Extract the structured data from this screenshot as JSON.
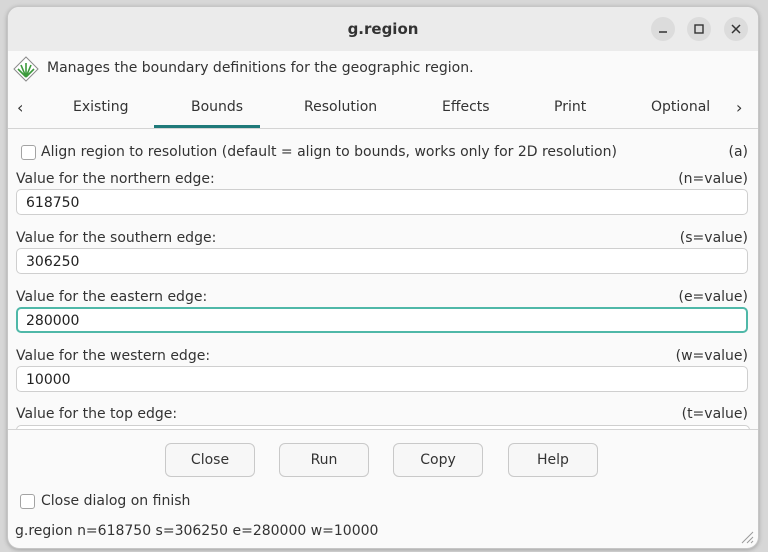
{
  "window": {
    "title": "g.region"
  },
  "header": {
    "description": "Manages the boundary definitions for the geographic region."
  },
  "tabs": {
    "prev": "‹",
    "next": "›",
    "items": [
      "Existing",
      "Bounds",
      "Resolution",
      "Effects",
      "Print",
      "Optional"
    ],
    "active": "Bounds"
  },
  "bounds": {
    "align": {
      "label": "Align region to resolution (default = align to bounds, works only for 2D resolution)",
      "key": "(a)",
      "checked": false
    },
    "north": {
      "label": "Value for the northern edge:",
      "key": "(n=value)",
      "value": "618750"
    },
    "south": {
      "label": "Value for the southern edge:",
      "key": "(s=value)",
      "value": "306250"
    },
    "east": {
      "label": "Value for the eastern edge:",
      "key": "(e=value)",
      "value": "280000"
    },
    "west": {
      "label": "Value for the western edge:",
      "key": "(w=value)",
      "value": "10000"
    },
    "top": {
      "label": "Value for the top edge:",
      "key": "(t=value)",
      "value": ""
    }
  },
  "buttons": {
    "close": "Close",
    "run": "Run",
    "copy": "Copy",
    "help": "Help"
  },
  "options": {
    "close_on_finish": {
      "label": "Close dialog on finish",
      "checked": false
    }
  },
  "status": {
    "command": "g.region n=618750 s=306250 e=280000 w=10000"
  },
  "colors": {
    "accent": "#1f7a7a",
    "focus_border": "#4fb8a8"
  }
}
